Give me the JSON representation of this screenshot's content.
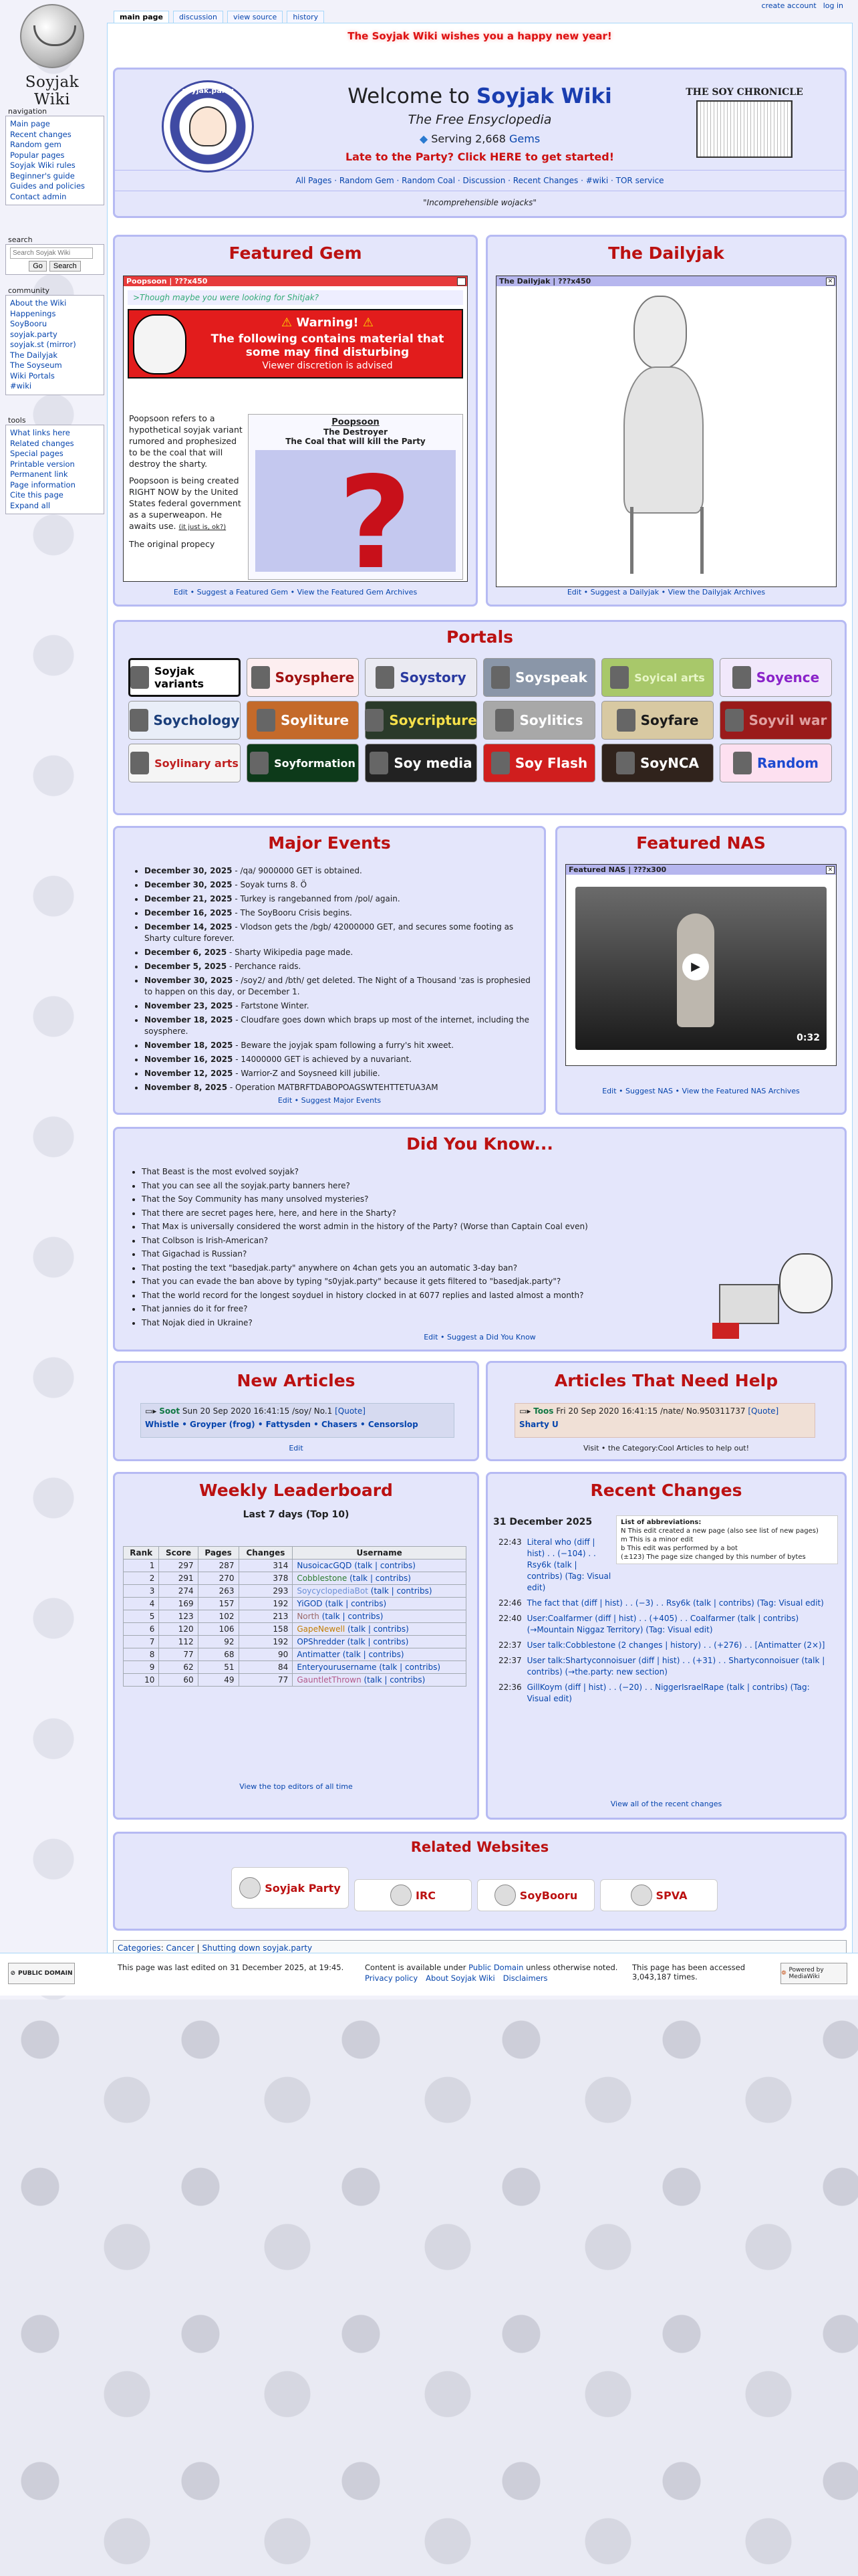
{
  "tabs": [
    "main page",
    "discussion",
    "view source",
    "history"
  ],
  "user_tools": [
    "create account",
    "log in"
  ],
  "logo_text": "Soyjak Wiki",
  "nav": {
    "title": "navigation",
    "items": [
      "Main page",
      "Recent changes",
      "Random gem",
      "Popular pages",
      "Soyjak Wiki rules",
      "Beginner's guide",
      "Guides and policies",
      "Contact admin"
    ]
  },
  "search": {
    "title": "search",
    "placeholder": "Search Soyjak Wiki",
    "go": "Go",
    "search": "Search"
  },
  "community": {
    "title": "community",
    "items": [
      "About the Wiki",
      "Happenings",
      "SoyBooru",
      "soyjak.party",
      "soyjak.st (mirror)",
      "The Dailyjak",
      "The Soyseum",
      "Wiki Portals",
      "#wiki"
    ]
  },
  "tools": {
    "title": "tools",
    "items": [
      "What links here",
      "Related changes",
      "Special pages",
      "Printable version",
      "Permanent link",
      "Page information",
      "Cite this page",
      "Expand all"
    ]
  },
  "banner": "The Soyjak Wiki wishes you a happy new year!",
  "welcome": {
    "title_a": "Welcome to ",
    "title_b": "Soyjak Wiki",
    "subtitle": "The Free Ensyclopedia",
    "serving": "Serving 2,668 ",
    "gems": "Gems",
    "party": "Late to the Party? Click HERE to get started!",
    "links": "All Pages · Random Gem · Random Coal · Discussion · Recent Changes · #wiki · TOR service",
    "quote": "\"Incomprehensible wojacks\"",
    "chronicle": "THE SOY CHRONICLE",
    "logo_text": "soyjak.party"
  },
  "featured_gem": {
    "title": "Featured Gem",
    "bar": "Poopsoon | ???x450",
    "though": ">Though maybe you were looking for Shitjak?",
    "warning_head": "Warning!",
    "warning_body": "The following contains material that some may find disturbing",
    "warning_sub": "Viewer discretion is advised",
    "p1": "Poopsoon refers to a hypothetical soyjak variant rumored and prophesized to be the coal that will destroy the sharty.",
    "p2": "Poopsoon is being created RIGHT NOW by the United States federal government as a superweapon. He awaits use.",
    "p2b": "(it just is, ok?)",
    "p3": "The original propecy",
    "card_name": "Poopsoon",
    "card_sub": "The Destroyer",
    "card_tag": "The Coal that will kill the Party",
    "footer": "Edit • Suggest a Featured Gem • View the Featured Gem Archives"
  },
  "dailyjak": {
    "title": "The Dailyjak",
    "bar": "The Dailyjak | ???x450",
    "footer": "Edit • Suggest a Dailyjak • View the Dailyjak Archives"
  },
  "portals": {
    "title": "Portals",
    "items": [
      {
        "label": "Soyjak variants",
        "bg": "#ffffff",
        "fg": "#000000"
      },
      {
        "label": "Soysphere",
        "bg": "#fdeef0",
        "fg": "#a01010"
      },
      {
        "label": "Soystory",
        "bg": "#eaeaf2",
        "fg": "#2a3aa0"
      },
      {
        "label": "Soyspeak",
        "bg": "#8a96a8",
        "fg": "#ffffff"
      },
      {
        "label": "Soyical arts",
        "bg": "#a8c86a",
        "fg": "#e8f6c8"
      },
      {
        "label": "Soyence",
        "bg": "#f1e8fb",
        "fg": "#8a23c9"
      },
      {
        "label": "Soychology",
        "bg": "#e9eef8",
        "fg": "#1b3e7a"
      },
      {
        "label": "Soyliture",
        "bg": "#c46a2a",
        "fg": "#ffffff"
      },
      {
        "label": "Soycripture",
        "bg": "#2a3a2a",
        "fg": "#f6e04a"
      },
      {
        "label": "Soylitics",
        "bg": "#a8a8a8",
        "fg": "#ffffff"
      },
      {
        "label": "Soyfare",
        "bg": "#d8c9a2",
        "fg": "#1a1a1a"
      },
      {
        "label": "Soyvil war",
        "bg": "#9a1a1a",
        "fg": "#e0a0a0"
      },
      {
        "label": "Soylinary arts",
        "bg": "#f5f5f5",
        "fg": "#c02020"
      },
      {
        "label": "Soyformation",
        "bg": "#0d3a1a",
        "fg": "#ffffff"
      },
      {
        "label": "Soy media",
        "bg": "#222222",
        "fg": "#ffffff"
      },
      {
        "label": "Soy Flash",
        "bg": "#d01e1e",
        "fg": "#ffffff"
      },
      {
        "label": "SoyNCA",
        "bg": "#30231c",
        "fg": "#ffffff"
      },
      {
        "label": "Random",
        "bg": "#fde0f0",
        "fg": "#1d4ad0"
      }
    ]
  },
  "major_events": {
    "title": "Major Events",
    "items": [
      {
        "date": "December 30, 2025",
        "text": " - /qa/ 9000000 GET is obtained."
      },
      {
        "date": "December 30, 2025",
        "text": " - Soyak turns 8. Ö"
      },
      {
        "date": "December 21, 2025",
        "text": " - Turkey is rangebanned from /pol/ again."
      },
      {
        "date": "December 16, 2025",
        "text": " - The SoyBooru Crisis begins."
      },
      {
        "date": "December 14, 2025",
        "text": " - Vlodson gets the /bgb/ 42000000 GET, and secures some footing as Sharty culture forever."
      },
      {
        "date": "December 6, 2025",
        "text": " - Sharty Wikipedia page made."
      },
      {
        "date": "December 5, 2025",
        "text": " - Perchance raids."
      },
      {
        "date": "November 30, 2025",
        "text": " - /soy2/ and /bth/ get deleted. The Night of a Thousand 'zas is prophesied to happen on this day, or December 1."
      },
      {
        "date": "November 23, 2025",
        "text": " - Fartstone Winter."
      },
      {
        "date": "November 18, 2025",
        "text": " - Cloudfare goes down which braps up most of the internet, including the soysphere."
      },
      {
        "date": "November 18, 2025",
        "text": " - Beware the joyjak spam following a furry's hit xweet."
      },
      {
        "date": "November 16, 2025",
        "text": " - 14000000 GET is achieved by a nuvariant."
      },
      {
        "date": "November 12, 2025",
        "text": " - Warrior-Z and Soysneed kill jubilie."
      },
      {
        "date": "November 8, 2025",
        "text": " - Operation MATBRFTDABOPOAGSWTEHTTETUA3AM"
      }
    ],
    "footer": "Edit • Suggest Major Events"
  },
  "featured_nas": {
    "title": "Featured NAS",
    "bar": "Featured NAS | ???x300",
    "duration": "0:32",
    "footer": "Edit • Suggest NAS • View the Featured NAS Archives"
  },
  "dyk": {
    "title": "Did You Know...",
    "items": [
      "That Beast is the most evolved soyjak?",
      "That you can see all the soyjak.party banners here?",
      "That the Soy Community has many unsolved mysteries?",
      "That there are secret pages here, here, and here in the Sharty?",
      "That Max is universally considered the worst admin in the history of the Party? (Worse than Captain Coal even)",
      "That Colbson is Irish-American?",
      "That Gigachad is Russian?",
      "That posting the text \"basedjak.party\" anywhere on 4chan gets you an automatic 3-day ban?",
      "That you can evade the ban above by typing \"s0yjak.party\" because it gets filtered to \"basedjak.party\"?",
      "That the world record for the longest soydueI in history clocked in at 6077 replies and lasted almost a month?",
      "That jannies do it for free?",
      "That Nojak died in Ukraine?"
    ],
    "footer": "Edit • Suggest a Did You Know"
  },
  "new_articles": {
    "title": "New Articles",
    "post_name": "Soot",
    "post_meta": "Sun 20 Sep 2020 16:41:15 /soy/ No.1",
    "quote": "[Quote]",
    "links": "Whistle • Groyper (frog) • Fattysden • Chasers • Censorslop",
    "footer": "Edit"
  },
  "need_help": {
    "title": "Articles That Need Help",
    "post_name": "Toos",
    "post_meta": "Fri 20 Sep 2020 16:41:15 /nate/ No.950311737",
    "quote": "[Quote]",
    "link": "Sharty U",
    "footer": "Visit • the Category:Cool Articles to help out!"
  },
  "leaderboard": {
    "title": "Weekly Leaderboard",
    "subtitle": "Last 7 days (Top 10)",
    "headers": [
      "Rank",
      "Score",
      "Pages",
      "Changes",
      "Username"
    ],
    "rows": [
      [
        "1",
        "297",
        "287",
        "314",
        "NusoicacGQD"
      ],
      [
        "2",
        "291",
        "270",
        "378",
        "Cobblestone"
      ],
      [
        "3",
        "274",
        "263",
        "293",
        "SoycyclopediaBot"
      ],
      [
        "4",
        "169",
        "157",
        "192",
        "YiGOD"
      ],
      [
        "5",
        "123",
        "102",
        "213",
        "North"
      ],
      [
        "6",
        "120",
        "106",
        "158",
        "GapeNewell"
      ],
      [
        "7",
        "112",
        "92",
        "192",
        "OPShredder"
      ],
      [
        "8",
        "77",
        "68",
        "90",
        "Antimatter"
      ],
      [
        "9",
        "62",
        "51",
        "84",
        "Enteryourusername"
      ],
      [
        "10",
        "60",
        "49",
        "77",
        "GauntletThrown"
      ]
    ],
    "colors": [
      "#0645ad",
      "#2e7d32",
      "#6a8fd8",
      "#0645ad",
      "#9b6a6a",
      "#c27c00",
      "#0645ad",
      "#0645ad",
      "#0645ad",
      "#b3598a"
    ],
    "suffix": " (talk | contribs)",
    "footer": "View the top editors of all time"
  },
  "recent": {
    "title": "Recent Changes",
    "date": "31 December 2025",
    "abbr_title": "List of abbreviations:",
    "abbr": [
      "N This edit created a new page (also see list of new pages)",
      "m This is a minor edit",
      "b This edit was performed by a bot",
      "(±123) The page size changed by this number of bytes"
    ],
    "entries": [
      {
        "time": "22:43",
        "text": "Literal who (diff | hist) . . (−104) . . Rsy6k (talk | contribs) (Tag: Visual edit)"
      },
      {
        "time": "22:46",
        "text": "The fact that (diff | hist) . . (−3) . . Rsy6k (talk | contribs) (Tag: Visual edit)"
      },
      {
        "time": "22:40",
        "text": "User:Coalfarmer (diff | hist) . . (+405) . . Coalfarmer (talk | contribs) (→Mountain Niggaz Territory) (Tag: Visual edit)"
      },
      {
        "time": "22:37",
        "text": "User talk:Cobblestone (2 changes | history) . . (+276) . . [Antimatter (2×)]"
      },
      {
        "time": "22:37",
        "text": "User talk:Shartyconnoisuer (diff | hist) . . (+31) . . Shartyconnoisuer (talk | contribs) (→the.party: new section)"
      },
      {
        "time": "22:36",
        "text": "GillKoym (diff | hist) . . (−20) . . NiggerIsraelRape (talk | contribs) (Tag: Visual edit)"
      }
    ],
    "footer": "View all of the recent changes"
  },
  "related": {
    "title": "Related Websites",
    "items": [
      "Soyjak Party",
      "IRC",
      "SoyBooru",
      "SPVA"
    ]
  },
  "categories": {
    "label": "Categories",
    "items": [
      "Cancer",
      "Shutting down soyjak.party"
    ]
  },
  "footer": {
    "edited": "This page was last edited on 31 December 2025, at 19:45.",
    "license_a": "Content is available under ",
    "license_link": "Public Domain",
    "license_b": " unless otherwise noted.",
    "accessed": "This page has been accessed 3,043,187 times.",
    "links": [
      "Privacy policy",
      "About Soyjak Wiki",
      "Disclaimers"
    ],
    "pd_badge": "PUBLIC DOMAIN",
    "mw_badge": "Powered by MediaWiki"
  }
}
